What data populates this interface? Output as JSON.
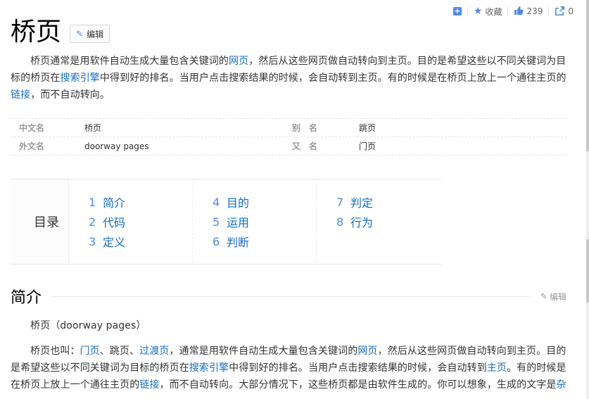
{
  "topbar": {
    "collect_label": "收藏",
    "like_count": "239",
    "share_count": "0"
  },
  "page": {
    "title": "桥页",
    "edit_label": "编辑"
  },
  "summary": {
    "s1": "桥页通常是用软件自动生成大量包含关键词的",
    "l1": "网页",
    "s2": "，然后从这些网页做自动转向到主页。目的是希望这些以不同关键词为目标的桥页在",
    "l2": "搜索引擎",
    "s3": "中得到好的排名。当用户点击搜索结果的时候，会自动转到主页。有的时候是在桥页上放上一个通往主页的",
    "l3": "链接",
    "s4": "，而不自动转向。"
  },
  "basic_info": {
    "rows": [
      {
        "k1": "中文名",
        "v1": "桥页",
        "k2": "别名",
        "v2": "跳页"
      },
      {
        "k1": "外文名",
        "v1": "doorway pages",
        "k2": "又名",
        "v2": "门页"
      }
    ]
  },
  "toc": {
    "title": "目录",
    "items": [
      {
        "num": "1",
        "label": "简介"
      },
      {
        "num": "2",
        "label": "代码"
      },
      {
        "num": "3",
        "label": "定义"
      },
      {
        "num": "4",
        "label": "目的"
      },
      {
        "num": "5",
        "label": "运用"
      },
      {
        "num": "6",
        "label": "判断"
      },
      {
        "num": "7",
        "label": "判定"
      },
      {
        "num": "8",
        "label": "行为"
      }
    ]
  },
  "section": {
    "title": "简介",
    "edit_label": "编辑",
    "p1": "桥页（doorway pages）",
    "p2": {
      "s1": "桥页也叫：",
      "l1": "门页",
      "s2": "、跳页、",
      "l2": "过渡页",
      "s3": "，通常是用软件自动生成大量包含关键词的",
      "l3": "网页",
      "s4": "，然后从这些网页做自动转向到主页。目的是希望这些以不同关键词为目标的桥页在",
      "l4": "搜索引擎",
      "s5": "中得到好的排名。当用户点击搜索结果的时候，会自动转到",
      "l5": "主页",
      "s6": "。有的时候是在桥页上放上一个通往主页的",
      "l6": "链接",
      "s7": "，而不自动转向。大部分情况下，这些桥页都是由软件生成的。你可以想象，生成的文字是",
      "l7": "杂"
    }
  },
  "colors": {
    "link": "#136ec2",
    "accent": "#4f8ae5"
  }
}
